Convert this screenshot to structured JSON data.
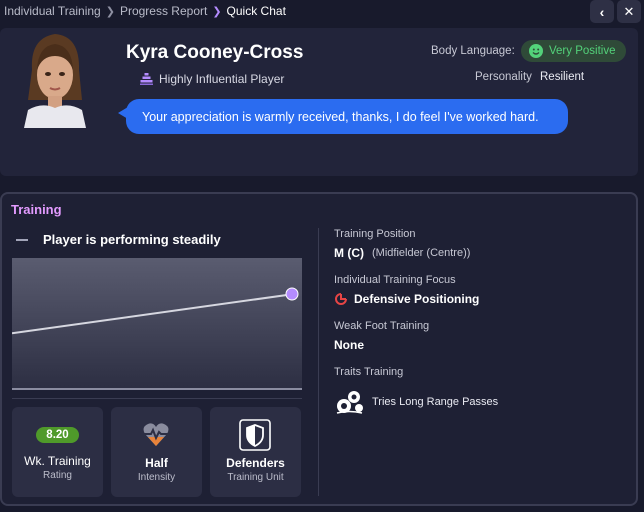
{
  "breadcrumb": {
    "items": [
      "Individual Training",
      "Progress Report",
      "Quick Chat"
    ]
  },
  "nav": {
    "back_icon": "chevron-left-icon",
    "close_icon": "close-icon"
  },
  "player": {
    "name": "Kyra Cooney-Cross",
    "status": "Highly Influential Player",
    "body_language_label": "Body Language:",
    "body_language_value": "Very Positive",
    "personality_label": "Personality",
    "personality_value": "Resilient",
    "message": "Your appreciation is warmly received, thanks, I do feel I've worked hard."
  },
  "training": {
    "title": "Training",
    "trend_text": "Player is performing steadily",
    "stats": [
      {
        "badge": "8.20",
        "label": "Wk. Training",
        "sub": "Rating"
      },
      {
        "label": "Half",
        "sub": "Intensity",
        "icon": "heart-icon"
      },
      {
        "label": "Defenders",
        "sub": "Training Unit",
        "icon": "shield-icon"
      }
    ],
    "position_label": "Training Position",
    "position_value": "M (C)",
    "position_detail": "(Midfielder (Centre))",
    "focus_label": "Individual Training Focus",
    "focus_value": "Defensive Positioning",
    "weak_foot_label": "Weak Foot Training",
    "weak_foot_value": "None",
    "traits_label": "Traits Training",
    "trait_value": "Tries Long Range Passes"
  },
  "colors": {
    "accent": "#b48cff",
    "positive": "#53d27a",
    "bubble": "#2b6cf0",
    "rating": "#4f9a2a",
    "focus": "#e74545"
  },
  "chart_data": {
    "type": "line",
    "series": [
      {
        "values": [
          0.15,
          0.5
        ]
      }
    ]
  }
}
